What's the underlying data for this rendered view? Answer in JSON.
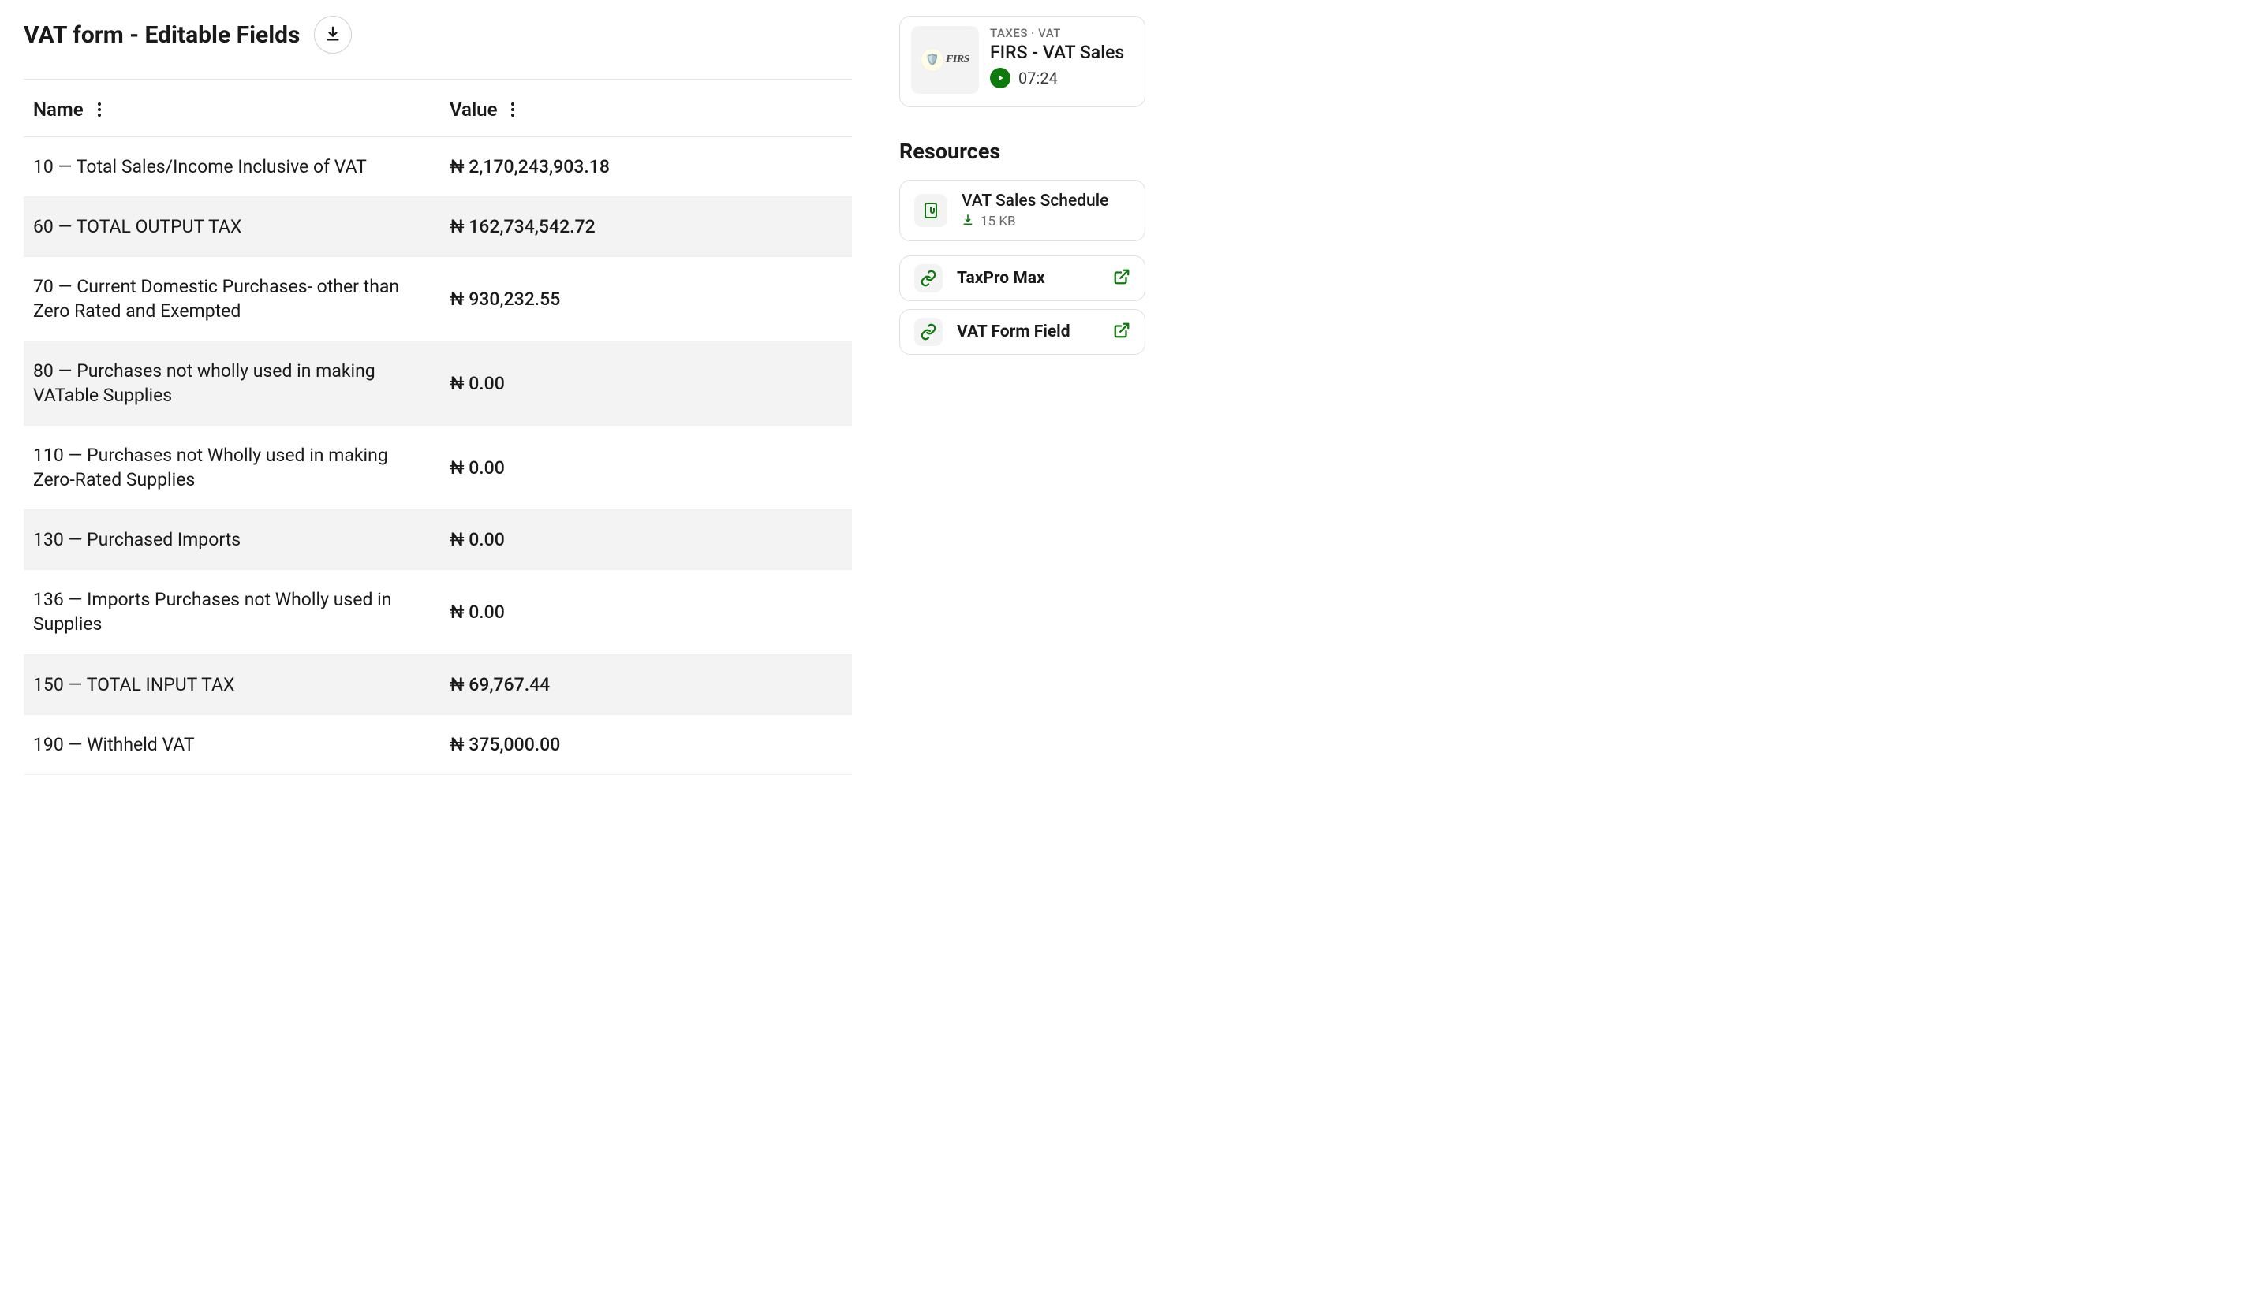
{
  "header": {
    "title": "VAT form - Editable Fields"
  },
  "table": {
    "columns": {
      "name": "Name",
      "value": "Value"
    },
    "rows": [
      {
        "name": "10 — Total Sales/Income Inclusive of VAT",
        "value": "₦ 2,170,243,903.18"
      },
      {
        "name": "60 — TOTAL OUTPUT TAX",
        "value": "₦ 162,734,542.72"
      },
      {
        "name": "70 — Current Domestic Purchases- other than Zero Rated and Exempted",
        "value": "₦ 930,232.55"
      },
      {
        "name": "80 — Purchases not wholly used in making VATable Supplies",
        "value": "₦ 0.00"
      },
      {
        "name": "110 — Purchases not Wholly used in making Zero-Rated Supplies",
        "value": "₦ 0.00"
      },
      {
        "name": "130 — Purchased Imports",
        "value": "₦ 0.00"
      },
      {
        "name": "136 — Imports Purchases not Wholly used in Supplies",
        "value": "₦ 0.00"
      },
      {
        "name": "150 — TOTAL INPUT TAX",
        "value": "₦ 69,767.44"
      },
      {
        "name": "190 — Withheld VAT",
        "value": "₦ 375,000.00"
      }
    ]
  },
  "video": {
    "meta": "TAXES · VAT",
    "title": "FIRS - VAT Sales",
    "duration": "07:24",
    "thumb_text": "FIRS"
  },
  "resources": {
    "heading": "Resources",
    "file": {
      "title": "VAT Sales Schedule",
      "size": "15 KB"
    },
    "links": [
      {
        "title": "TaxPro Max"
      },
      {
        "title": "VAT Form Field"
      }
    ]
  }
}
